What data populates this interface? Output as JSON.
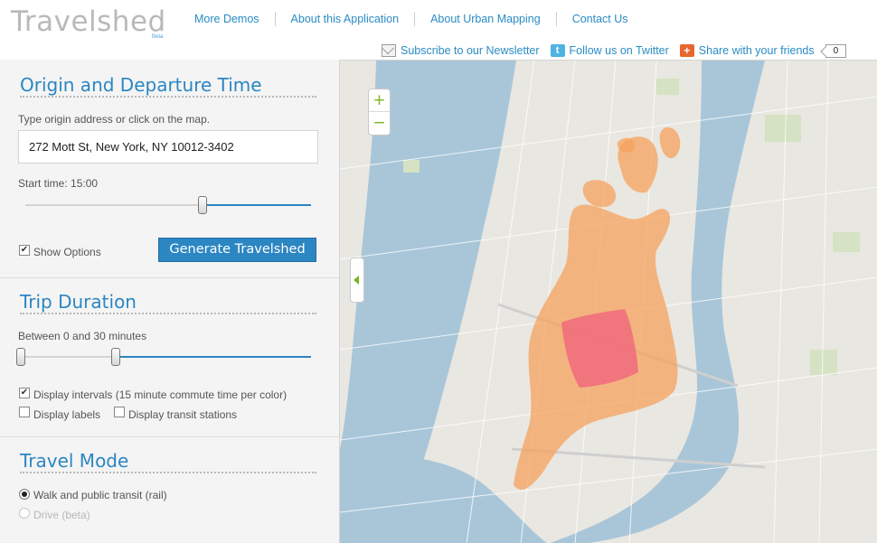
{
  "header": {
    "logo": "Travelshed",
    "logo_badge": "Beta",
    "nav": [
      "More Demos",
      "About this Application",
      "About Urban Mapping",
      "Contact Us"
    ],
    "social": {
      "newsletter": "Subscribe to our Newsletter",
      "twitter": "Follow us on Twitter",
      "share": "Share with your friends",
      "share_count": "0"
    }
  },
  "origin": {
    "title": "Origin and Departure Time",
    "hint": "Type origin address or click on the map.",
    "address": "272 Mott St, New York, NY  10012-3402",
    "start_time_label": "Start time: 15:00",
    "start_time_position": 0.62,
    "show_options_label": "Show Options",
    "show_options_checked": true,
    "generate_label": "Generate Travelshed"
  },
  "duration": {
    "title": "Trip Duration",
    "range_label": "Between 0 and 30 minutes",
    "range_min": 0,
    "range_max": 30,
    "display_intervals_label": "Display intervals (15 minute commute time per color)",
    "display_intervals_checked": true,
    "display_labels_label": "Display labels",
    "display_labels_checked": false,
    "display_stations_label": "Display transit stations",
    "display_stations_checked": false
  },
  "travel_mode": {
    "title": "Travel Mode",
    "options": [
      {
        "label": "Walk and public transit (rail)",
        "selected": true,
        "enabled": true
      },
      {
        "label": "Drive (beta)",
        "selected": false,
        "enabled": false
      }
    ]
  },
  "map": {
    "zoom_in": "+",
    "zoom_out": "−",
    "colors": {
      "water": "#a9c6d9",
      "land": "#e9e7e1",
      "park": "#d5e2c3",
      "interval_30": "#f5a15c",
      "interval_15": "#f06a7c",
      "accent": "#2b86c2"
    }
  }
}
